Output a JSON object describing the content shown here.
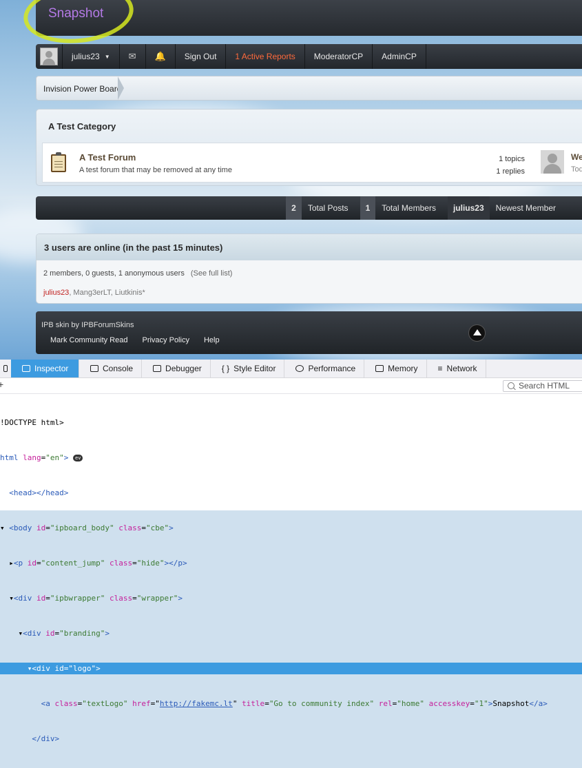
{
  "site": {
    "logo": "Snapshot"
  },
  "userbar": {
    "username": "julius23",
    "sign_out": "Sign Out",
    "reports": "1 Active Reports",
    "moderator": "ModeratorCP",
    "admin": "AdminCP"
  },
  "breadcrumb": {
    "root": "Invision Power Board"
  },
  "category": {
    "title": "A Test Category",
    "forum": {
      "name": "A Test Forum",
      "description": "A test forum that may be removed at any time",
      "topics": "1 topics",
      "replies": "1 replies",
      "last_title": "We",
      "last_date": "Tod"
    }
  },
  "stats": {
    "posts_count": "2",
    "posts_label": "Total Posts",
    "members_count": "1",
    "members_label": "Total Members",
    "newest_name": "julius23",
    "newest_label": "Newest Member"
  },
  "online": {
    "title": "3 users are online (in the past 15 minutes)",
    "summary": "2 members, 0 guests, 1 anonymous users",
    "full_list": "(See full list)",
    "user1": "julius23",
    "others": ", Mang3erLT, Liutkinis*"
  },
  "footer": {
    "skin": "IPB skin by IPBForumSkins",
    "links": [
      "Mark Community Read",
      "Privacy Policy",
      "Help"
    ]
  },
  "devtools": {
    "tabs": [
      "Inspector",
      "Console",
      "Debugger",
      "Style Editor",
      "Performance",
      "Memory",
      "Network"
    ],
    "search_placeholder": "Search HTML",
    "ev_badge": "ev",
    "lines": {
      "l1": "!DOCTYPE html>",
      "l2_tag": "html",
      "l2_attr": "lang",
      "l2_val": "\"en\"",
      "l3": "<head></head>",
      "l4_tag": "<body",
      "l4_a1": "id",
      "l4_v1": "\"ipboard_body\"",
      "l4_a2": "class",
      "l4_v2": "\"cbe\"",
      "l5_tag": "<p",
      "l5_a1": "id",
      "l5_v1": "\"content_jump\"",
      "l5_a2": "class",
      "l5_v2": "\"hide\"",
      "l5_end": "></p>",
      "l6_tag": "<div",
      "l6_a1": "id",
      "l6_v1": "\"ipbwrapper\"",
      "l6_a2": "class",
      "l6_v2": "\"wrapper\"",
      "l7_tag": "<div",
      "l7_a1": "id",
      "l7_v1": "\"branding\"",
      "l8_tag": "<div",
      "l8_a1": "id",
      "l8_v1": "\"logo\"",
      "l9_tag": "<a",
      "l9_a1": "class",
      "l9_v1": "\"textLogo\"",
      "l9_a2": "href",
      "l9_v2": "http://fakemc.lt",
      "l9_a3": "title",
      "l9_v3": "\"Go to community index\"",
      "l9_a4": "rel",
      "l9_v4": "\"home\"",
      "l9_a5": "accesskey",
      "l9_v5": "\"1\"",
      "l9_text": "Snapshot",
      "l10": "</div>"
    }
  }
}
